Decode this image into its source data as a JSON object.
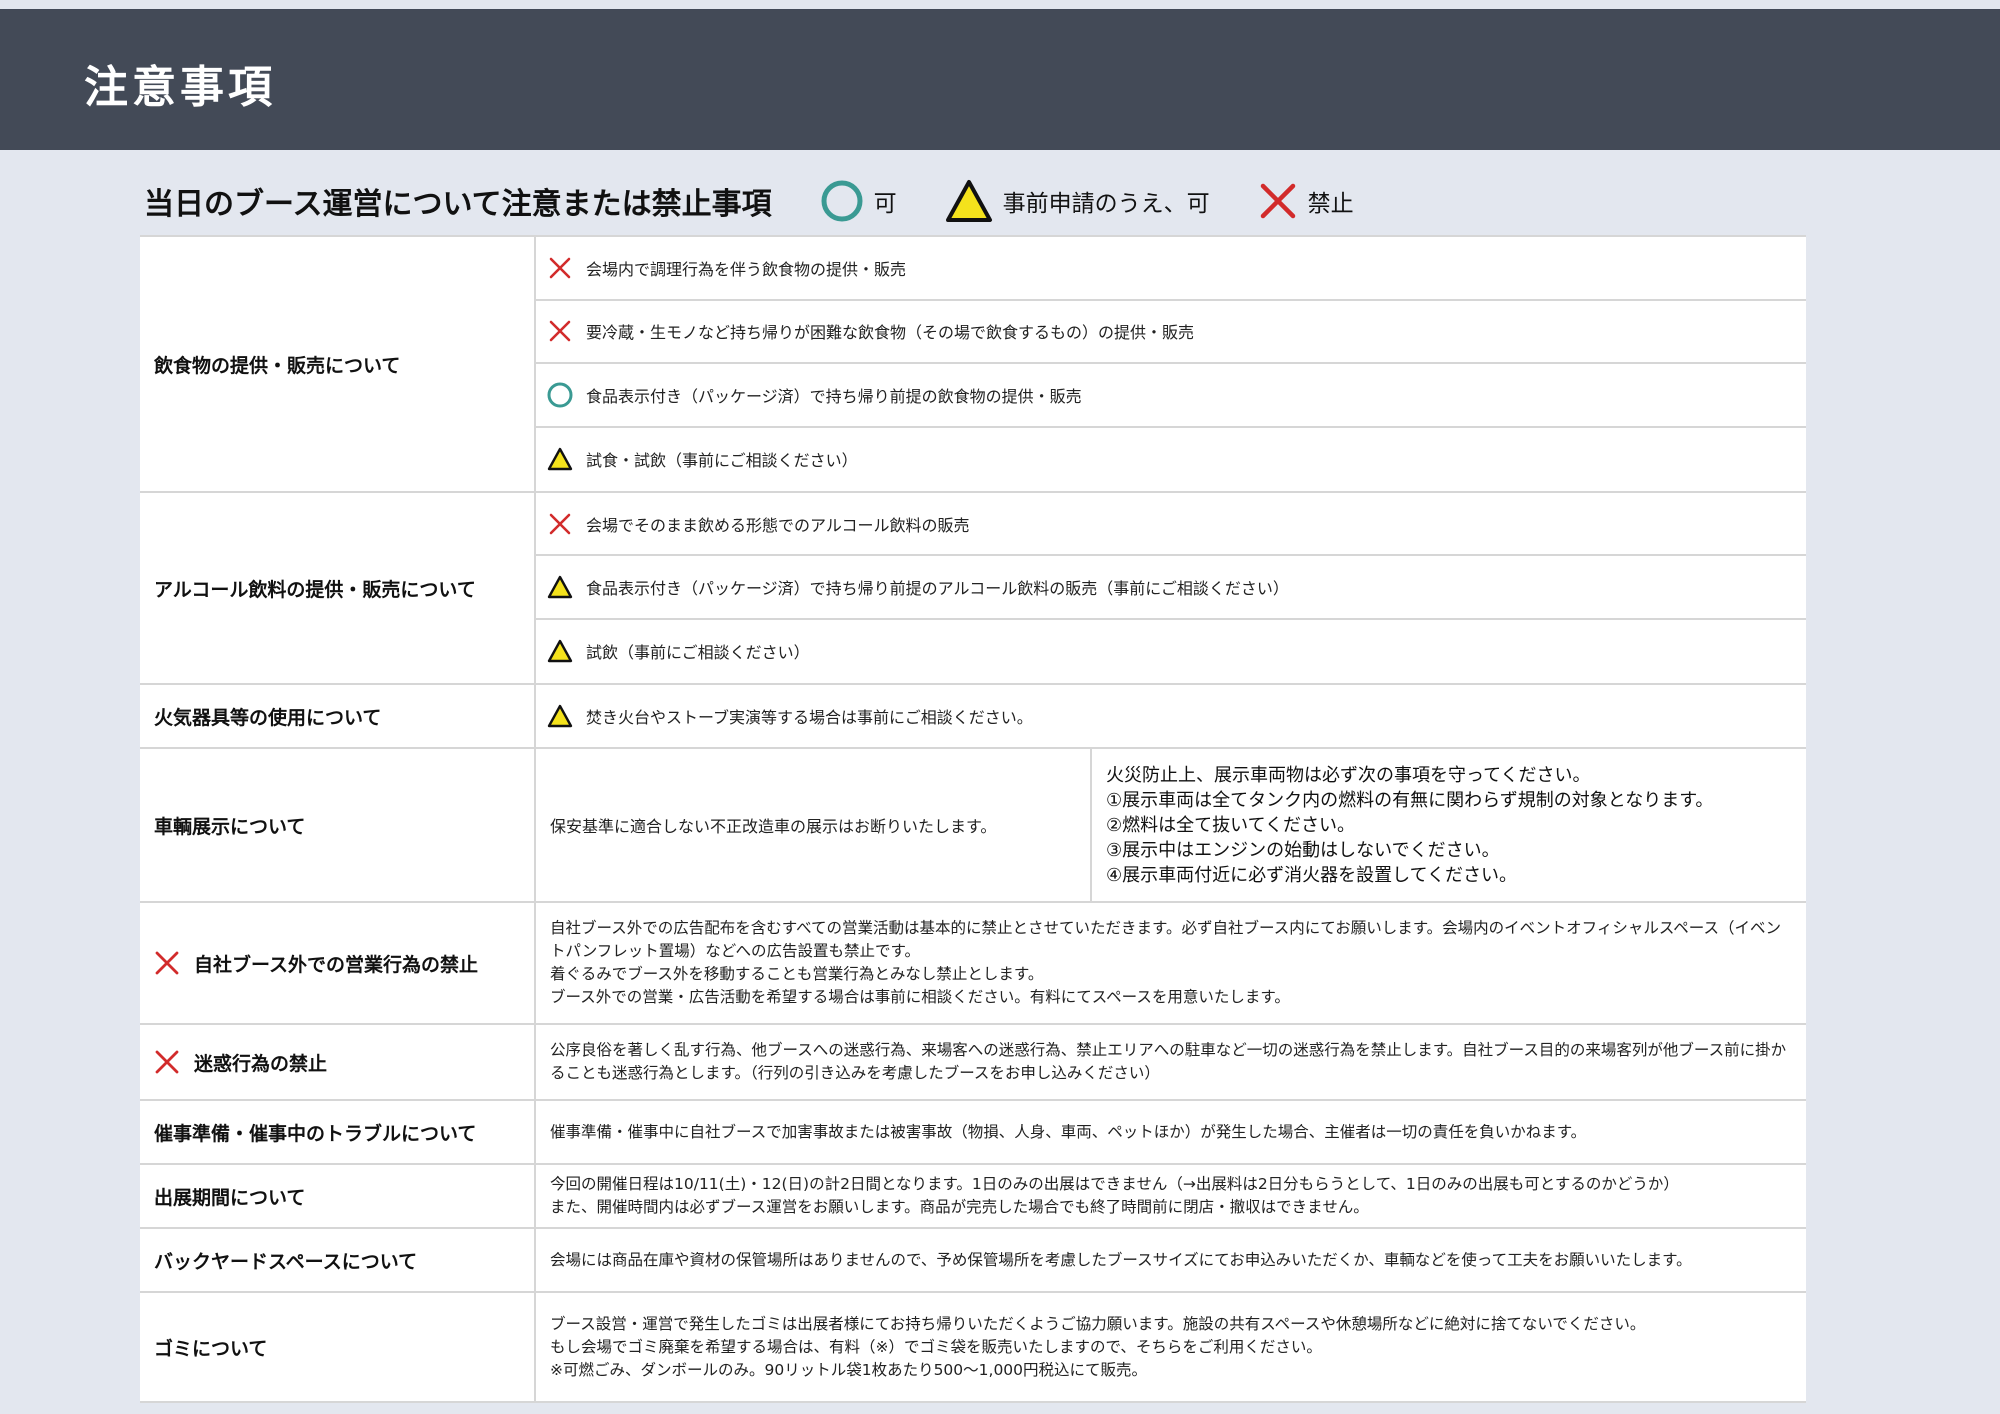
{
  "header": {
    "title": "注意事項"
  },
  "subheading": {
    "title": "当日のブース運営について注意または禁止事項",
    "legend": [
      {
        "icon": "circle-icon",
        "label": "可"
      },
      {
        "icon": "triangle-icon",
        "label": "事前申請のうえ、可"
      },
      {
        "icon": "cross-icon",
        "label": "禁止"
      }
    ]
  },
  "colors": {
    "header_bg": "#434a57",
    "page_bg": "#e3e7ef",
    "circle": "#3a9a93",
    "triangle_fill": "#f4e21c",
    "cross": "#d22b2b"
  },
  "rows": {
    "food": {
      "category": "飲食物の提供・販売について",
      "items": [
        {
          "icon": "cross-icon",
          "text": "会場内で調理行為を伴う飲食物の提供・販売"
        },
        {
          "icon": "cross-icon",
          "text": "要冷蔵・生モノなど持ち帰りが困難な飲食物（その場で飲食するもの）の提供・販売"
        },
        {
          "icon": "circle-icon",
          "text": "食品表示付き（パッケージ済）で持ち帰り前提の飲食物の提供・販売"
        },
        {
          "icon": "triangle-icon",
          "text": "試食・試飲（事前にご相談ください）"
        }
      ]
    },
    "alcohol": {
      "category": "アルコール飲料の提供・販売について",
      "items": [
        {
          "icon": "cross-icon",
          "text": "会場でそのまま飲める形態でのアルコール飲料の販売"
        },
        {
          "icon": "triangle-icon",
          "text": "食品表示付き（パッケージ済）で持ち帰り前提のアルコール飲料の販売（事前にご相談ください）"
        },
        {
          "icon": "triangle-icon",
          "text": "試飲（事前にご相談ください）"
        }
      ]
    },
    "fire": {
      "category": "火気器具等の使用について",
      "items": [
        {
          "icon": "triangle-icon",
          "text": "焚き火台やストーブ実演等する場合は事前にご相談ください。"
        }
      ]
    },
    "vehicle": {
      "category": "車輌展示について",
      "left": "保安基準に適合しない不正改造車の展示はお断りいたします。",
      "right": [
        "火災防止上、展示車両物は必ず次の事項を守ってください。",
        "①展示車両は全てタンク内の燃料の有無に関わらず規制の対象となります。",
        "②燃料は全て抜いてください。",
        "③展示中はエンジンの始動はしないでください。",
        "④展示車両付近に必ず消火器を設置してください。"
      ]
    },
    "sales": {
      "category": "自社ブース外での営業行為の禁止",
      "lines": [
        "自社ブース外での広告配布を含むすべての営業活動は基本的に禁止とさせていただきます。必ず自社ブース内にてお願いします。会場内のイベントオフィシャルスペース（イベントパンフレット置場）などへの広告設置も禁止です。",
        "着ぐるみでブース外を移動することも営業行為とみなし禁止とします。",
        "ブース外での営業・広告活動を希望する場合は事前に相談ください。有料にてスペースを用意いたします。"
      ]
    },
    "nuisance": {
      "category": "迷惑行為の禁止",
      "lines": [
        "公序良俗を著しく乱す行為、他ブースへの迷惑行為、来場客への迷惑行為、禁止エリアへの駐車など一切の迷惑行為を禁止します。自社ブース目的の来場客列が他ブース前に掛かることも迷惑行為とします。（行列の引き込みを考慮したブースをお申し込みください）"
      ]
    },
    "trouble": {
      "category": "催事準備・催事中のトラブルについて",
      "lines": [
        "催事準備・催事中に自社ブースで加害事故または被害事故（物損、人身、車両、ペットほか）が発生した場合、主催者は一切の責任を負いかねます。"
      ]
    },
    "period": {
      "category": "出展期間について",
      "lines": [
        "今回の開催日程は10/11(土)・12(日)の計2日間となります。1日のみの出展はできません（→出展料は2日分もらうとして、1日のみの出展も可とするのかどうか）",
        "また、開催時間内は必ずブース運営をお願いします。商品が完売した場合でも終了時間前に閉店・撤収はできません。"
      ]
    },
    "backyard": {
      "category": "バックヤードスペースについて",
      "lines": [
        "会場には商品在庫や資材の保管場所はありませんので、予め保管場所を考慮したブースサイズにてお申込みいただくか、車輌などを使って工夫をお願いいたします。"
      ]
    },
    "garbage": {
      "category": "ゴミについて",
      "lines": [
        "ブース設営・運営で発生したゴミは出展者様にてお持ち帰りいただくようご協力願います。施設の共有スペースや休憩場所などに絶対に捨てないでください。",
        "もし会場でゴミ廃棄を希望する場合は、有料（※）でゴミ袋を販売いたしますので、そちらをご利用ください。",
        "※可燃ごみ、ダンボールのみ。90リットル袋1枚あたり500〜1,000円税込にて販売。"
      ]
    }
  }
}
